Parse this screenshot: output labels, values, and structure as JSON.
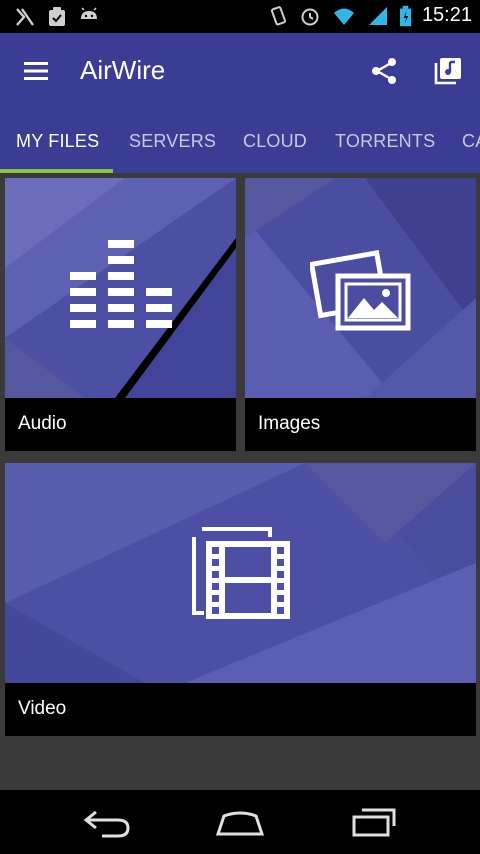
{
  "status_bar": {
    "time": "15:21"
  },
  "app_bar": {
    "title": "AirWire"
  },
  "tabs": [
    {
      "label": "MY FILES",
      "active": true
    },
    {
      "label": "SERVERS",
      "active": false
    },
    {
      "label": "CLOUD",
      "active": false
    },
    {
      "label": "TORRENTS",
      "active": false
    },
    {
      "label": "CA",
      "active": false
    }
  ],
  "tiles": {
    "audio": {
      "label": "Audio",
      "icon": "equalizer-icon"
    },
    "images": {
      "label": "Images",
      "icon": "images-icon"
    },
    "video": {
      "label": "Video",
      "icon": "film-icon"
    }
  },
  "colors": {
    "primary": "#3a3d93",
    "tab_indicator": "#8bc34a",
    "tile_bg": "#4a4ca0",
    "caption_bg": "#000000"
  }
}
